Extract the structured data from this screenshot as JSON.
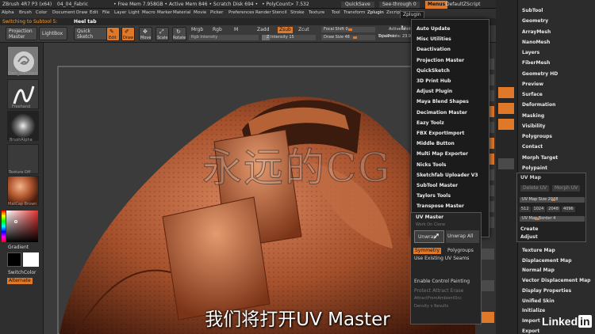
{
  "titlebar": {
    "app": "ZBrush 4R7 P3 (x64)",
    "doc": "04_04_Fabric",
    "free_mem": "• Free Mem 7.958GB • Active Mem 846 • Scratch Disk 694 •",
    "polycount": "• PolyCount> 7.532",
    "quicksave": "QuickSave",
    "seethrough": "See-through  0",
    "menus": "Menus",
    "script": "DefaultZScript"
  },
  "menubar": {
    "items": [
      "Alpha",
      "Brush",
      "Color",
      "Document",
      "Draw",
      "Edit",
      "File",
      "Layer",
      "Light",
      "Macro",
      "Marker",
      "Material",
      "Movie",
      "Picker",
      "Preferences",
      "Render",
      "Stencil",
      "Stroke",
      "Texture",
      "Tool",
      "Transform",
      "Zplugin",
      "Zscript"
    ]
  },
  "subbar": {
    "switching": "Switching to Subtool 5:",
    "heel": "Heel tab"
  },
  "toolbar": {
    "projection_master": "Projection Master",
    "lightbox": "LightBox",
    "quick_sketch": "Quick Sketch",
    "edit": "Edit",
    "draw": "Draw",
    "move": "Move",
    "scale": "Scale",
    "rotate": "Rotate",
    "rgb_intensity": "Rgb Intensity",
    "mrgb": "Mrgb",
    "rgb": "Rgb",
    "m": "M",
    "zadd": "Zadd",
    "zsub": "Zsub",
    "zcut": "Zcut",
    "z_intensity": "Z Intensity 15",
    "focal_shift": "Focal Shift 0",
    "draw_size": "Draw Size 48",
    "dynamic": "Dynamic",
    "active_points": "ActivePoints: 37,",
    "total_points": "TotalPoints: 23.93"
  },
  "leftpanel": {
    "brush": "Dam_Standard",
    "stroke": "Freehand",
    "alpha": "BrushAlpha",
    "texture": "Texture Off",
    "material": "MatCap Brown",
    "gradient": "Gradient",
    "switch_color": "SwitchColor",
    "alternate": "Alternate"
  },
  "zplugin_menu": {
    "items": [
      "Auto Update",
      "Misc Utilities",
      "Deactivation",
      "Projection Master",
      "QuickSketch",
      "3D Print Hub",
      "Adjust Plugin",
      "Maya Blend Shapes",
      "Decimation Master",
      "Eazy Toolz",
      "FBX ExportImport",
      "Middle Button",
      "Multi Map Exporter",
      "Nicks Tools",
      "Sketchfab Uploader V3",
      "SubTool Master",
      "Taylors Tools",
      "Transpose Master",
      "UV Master"
    ]
  },
  "uv_master": {
    "header": "UV Master",
    "workon": "Work On Clone",
    "unwrap": "Unwrap",
    "unwrap_all": "Unwrap All",
    "symmetry": "Symmetry",
    "polygroups": "Polygroups",
    "use_existing": "Use Existing UV Seams",
    "painting": "Enable Control Painting",
    "protect": "Protect   Attract   Erase",
    "attract": "AttractFromAmbientOcc",
    "density": "Density x  Results"
  },
  "rightpanel": {
    "items_top": [
      "SubTool",
      "Geometry",
      "ArrayMesh",
      "NanoMesh",
      "Layers",
      "FiberMesh",
      "Geometry HD",
      "Preview",
      "Surface",
      "Deformation",
      "Masking",
      "Visibility",
      "Polygroups",
      "Contact",
      "Morph Target",
      "Polypaint",
      "UV Map"
    ],
    "uv_map": {
      "morph_uv": "Morph UV",
      "delete_uv": "Delete UV",
      "size_label": "UV Map Size 2048",
      "sizes": [
        "512",
        "1024",
        "2048",
        "4096"
      ],
      "border": "UV Map Border 4",
      "create": "Create",
      "adjust": "Adjust"
    },
    "items_bottom": [
      "Texture Map",
      "Displacement Map",
      "Normal Map",
      "Vector Displacement Map",
      "Display Properties",
      "Unified Skin",
      "Initialize",
      "Import",
      "Export"
    ]
  },
  "overlay": {
    "subtitle": "我们将打开UV Master",
    "watermark": "永远的CG",
    "brand_text": "Linked",
    "brand_in": "in"
  }
}
